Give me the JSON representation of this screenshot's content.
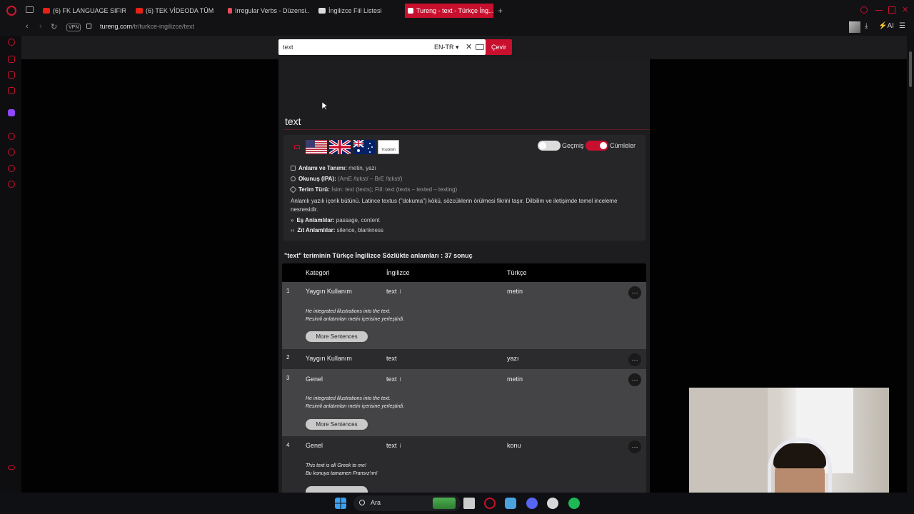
{
  "browser": {
    "tabs": [
      {
        "label": "(6) FK LANGUAGE SIFIRD..."
      },
      {
        "label": "(6) TEK VİDEODA TÜM İN..."
      },
      {
        "label": "Irregular Verbs - Düzensi..."
      },
      {
        "label": "İngilizce Fiil Listesi"
      },
      {
        "label": "Tureng - text - Türkçe İng..."
      }
    ],
    "new_tab": "+",
    "vpn": "VPN",
    "url_host": "tureng.com",
    "url_path": "/tr/turkce-ingilizce/text",
    "ai_label": "AI"
  },
  "search": {
    "value": "text",
    "lang": "EN-TR ▾",
    "clear": "✕",
    "button": "Çevir"
  },
  "word": {
    "title": "text",
    "youglish": "YouGlish",
    "toggles": [
      {
        "label": "Geçmiş",
        "on": false
      },
      {
        "label": "Cümleler",
        "on": true
      }
    ],
    "meaning_label": "Anlamı ve Tanımı:",
    "meaning_value": "metin, yazı",
    "pron_label": "Okunuş (IPA):",
    "pron_value": "(AmE /tɛkst/ – BrE /tɛkst/)",
    "type_label": "Terim Türü:",
    "type_value": "İsim: text (texts); Fiil: text (texts – texted – texting)",
    "description": "Anlamlı yazılı içerik bütünü. Latince textus (\"dokuma\") kökü, sözcüklerin örülmesi fikrini taşır. Dilbilim ve iletişimde temel inceleme nesnesidir.",
    "syn_label": "Eş Anlamlılar:",
    "syn_value": "passage, content",
    "ant_label": "Zıt Anlamlılar:",
    "ant_value": "silence, blankness"
  },
  "results": {
    "title": "\"text\" teriminin Türkçe İngilizce Sözlükte anlamları : 37 sonuç",
    "headers": {
      "category": "Kategori",
      "english": "İngilizce",
      "turkish": "Türkçe"
    },
    "more": "More Sentences",
    "dots": "···",
    "info": "i",
    "rows": [
      {
        "num": "1",
        "category": "Yaygın Kullanım",
        "english": "text",
        "turkish": "metin",
        "ex_en": "He integrated illustrations into the text.",
        "ex_tr": "Resimli anlatımları metin içerisine yerleştirdi."
      },
      {
        "num": "2",
        "category": "Yaygın Kullanım",
        "english": "text",
        "turkish": "yazı"
      },
      {
        "num": "3",
        "category": "Genel",
        "english": "text",
        "turkish": "metin",
        "ex_en": "He integrated illustrations into the text.",
        "ex_tr": "Resimli anlatımları metin içerisine yerleştirdi."
      },
      {
        "num": "4",
        "category": "Genel",
        "english": "text",
        "turkish": "konu",
        "ex_en": "This text is all Greek to me!",
        "ex_tr": "Bu konuya tamamen Fransız'ım!"
      }
    ]
  },
  "taskbar": {
    "search_label": "Ara"
  },
  "colors": {
    "accent": "#c8102e",
    "row_light": "#444446",
    "row_dark": "#2b2b2d"
  }
}
